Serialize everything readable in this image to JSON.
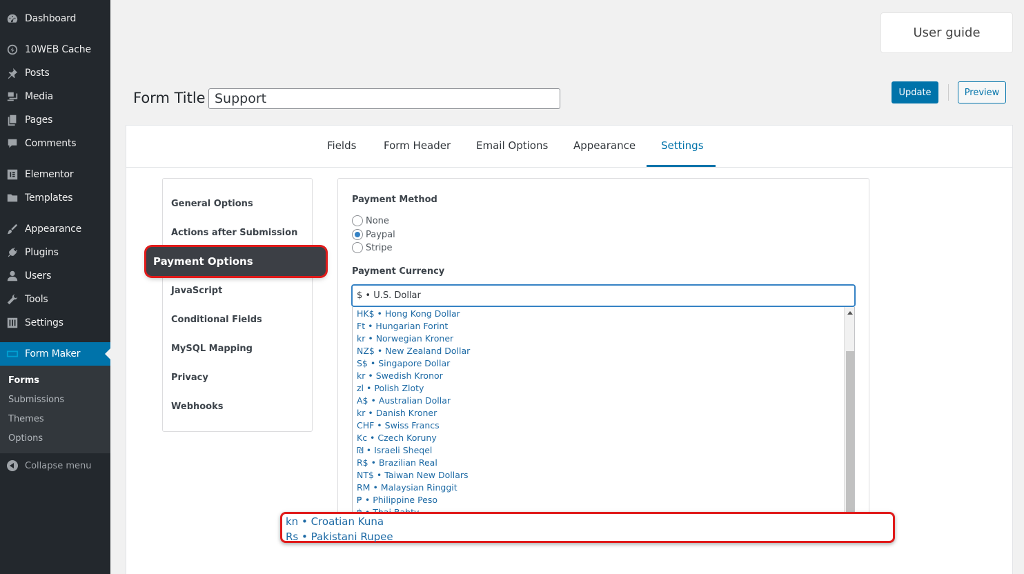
{
  "sidebar": {
    "items": [
      {
        "label": "Dashboard",
        "icon": "dashboard-icon"
      },
      {
        "label": "10WEB Cache",
        "icon": "cache-icon"
      },
      {
        "label": "Posts",
        "icon": "pin-icon"
      },
      {
        "label": "Media",
        "icon": "media-icon"
      },
      {
        "label": "Pages",
        "icon": "pages-icon"
      },
      {
        "label": "Comments",
        "icon": "comment-icon"
      },
      {
        "label": "Elementor",
        "icon": "elementor-icon"
      },
      {
        "label": "Templates",
        "icon": "folder-icon"
      },
      {
        "label": "Appearance",
        "icon": "brush-icon"
      },
      {
        "label": "Plugins",
        "icon": "plug-icon"
      },
      {
        "label": "Users",
        "icon": "user-icon"
      },
      {
        "label": "Tools",
        "icon": "wrench-icon"
      },
      {
        "label": "Settings",
        "icon": "sliders-icon"
      },
      {
        "label": "Form Maker",
        "icon": "form-maker-icon"
      }
    ],
    "submenu": [
      "Forms",
      "Submissions",
      "Themes",
      "Options"
    ],
    "collapse_label": "Collapse menu"
  },
  "header": {
    "user_guide": "User guide",
    "form_title_label": "Form Title",
    "form_title_value": "Support",
    "update_label": "Update",
    "preview_label": "Preview"
  },
  "tabs": [
    "Fields",
    "Form Header",
    "Email Options",
    "Appearance",
    "Settings"
  ],
  "active_tab": "Settings",
  "settings_nav": [
    "General Options",
    "Actions after Submission",
    "Payment Options",
    "JavaScript",
    "Conditional Fields",
    "MySQL Mapping",
    "Privacy",
    "Webhooks"
  ],
  "payment": {
    "method_title": "Payment Method",
    "methods": [
      "None",
      "Paypal",
      "Stripe"
    ],
    "selected_method": "Paypal",
    "currency_title": "Payment Currency",
    "selected_currency": "$ • U.S. Dollar",
    "currency_options": [
      "HK$ • Hong Kong Dollar",
      "Ft • Hungarian Forint",
      "kr • Norwegian Kroner",
      "NZ$ • New Zealand Dollar",
      "S$ • Singapore Dollar",
      "kr • Swedish Kronor",
      "zl • Polish Zloty",
      "A$ • Australian Dollar",
      "kr • Danish Kroner",
      "CHF • Swiss Francs",
      "Kc • Czech Koruny",
      "₪ • Israeli Sheqel",
      "R$ • Brazilian Real",
      "NT$ • Taiwan New Dollars",
      "RM • Malaysian Ringgit",
      "₱ • Philippine Peso",
      "฿ • Thai Bahtv"
    ],
    "highlighted_options": [
      "kn • Croatian Kuna",
      "Rs • Pakistani Rupee"
    ]
  },
  "colors": {
    "sidebar_bg": "#23282d",
    "accent": "#0073aa",
    "highlight_border": "#e01b1b"
  }
}
